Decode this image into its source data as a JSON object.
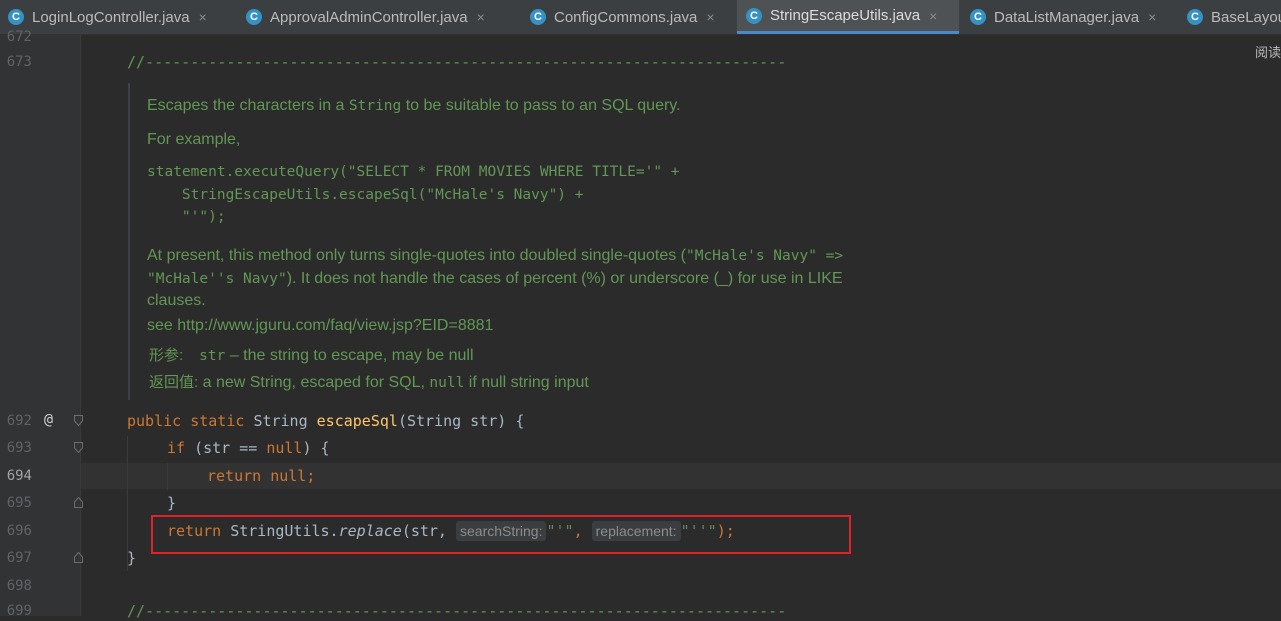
{
  "tabs": [
    {
      "label": "LoginLogController.java",
      "icon": "C",
      "close": "×",
      "active": false
    },
    {
      "label": "ApprovalAdminController.java",
      "icon": "C",
      "close": "×",
      "active": false
    },
    {
      "label": "ConfigCommons.java",
      "icon": "C",
      "close": "×",
      "active": false
    },
    {
      "label": "StringEscapeUtils.java",
      "icon": "C",
      "close": "×",
      "active": true
    },
    {
      "label": "DataListManager.java",
      "icon": "C",
      "close": "×",
      "active": false
    },
    {
      "label": "BaseLayou",
      "icon": "C",
      "close": "",
      "active": false
    }
  ],
  "reader_mode": "阅读",
  "gutter": {
    "annotation_marker": "@",
    "line_numbers": [
      {
        "n": "672",
        "current": false
      },
      {
        "n": "673",
        "current": false
      },
      {
        "n": "692",
        "current": false
      },
      {
        "n": "693",
        "current": false
      },
      {
        "n": "694",
        "current": true
      },
      {
        "n": "695",
        "current": false
      },
      {
        "n": "696",
        "current": false
      },
      {
        "n": "697",
        "current": false
      },
      {
        "n": "698",
        "current": false
      },
      {
        "n": "699",
        "current": false
      }
    ]
  },
  "separator_comment": "//-----------------------------------------------------------------------",
  "javadoc": {
    "line1_pre": "Escapes the characters in a ",
    "line1_code": "String",
    "line1_post": " to be suitable to pass to an SQL query.",
    "example_label": "For example,",
    "example_code": [
      "statement.executeQuery(\"SELECT * FROM MOVIES WHERE TITLE='\" +",
      "    StringEscapeUtils.escapeSql(\"McHale's Navy\") +",
      "    \"'\");"
    ],
    "present_pre": "At present, this method only turns single-quotes into doubled single-quotes (",
    "present_code1": "\"McHale's Navy\" =>",
    "present_code2": "\"McHale''s Navy\"",
    "present_post": "). It does not handle the cases of percent (%) or underscore (_) for use in LIKE",
    "present_end": "clauses.",
    "see": "see http://www.jguru.com/faq/view.jsp?EID=8881",
    "param_label": "形参:",
    "param_name": "str",
    "param_desc": " – the string to escape, may be null",
    "return_label": "返回值:",
    "return_pre": " a new String, escaped for SQL, ",
    "return_code": "null",
    "return_post": " if null string input"
  },
  "code": {
    "l692_public": "public",
    "l692_static": "static",
    "l692_type": "String",
    "l692_method": "escapeSql",
    "l692_params": "(String str) {",
    "l693_if": "if",
    "l693_cond1": " (str == ",
    "l693_null": "null",
    "l693_cond2": ") {",
    "l694_return": "return",
    "l694_null": "null",
    "l694_semi": ";",
    "l695_brace": "}",
    "l696_return": "return",
    "l696_call": "StringUtils.",
    "l696_method": "replace",
    "l696_args1": "(str, ",
    "hint1": "searchString:",
    "str1": "\"'\"",
    "comma": ", ",
    "hint2": "replacement:",
    "str2": "\"''\"",
    "l696_end": ");",
    "l697_brace": "}"
  }
}
